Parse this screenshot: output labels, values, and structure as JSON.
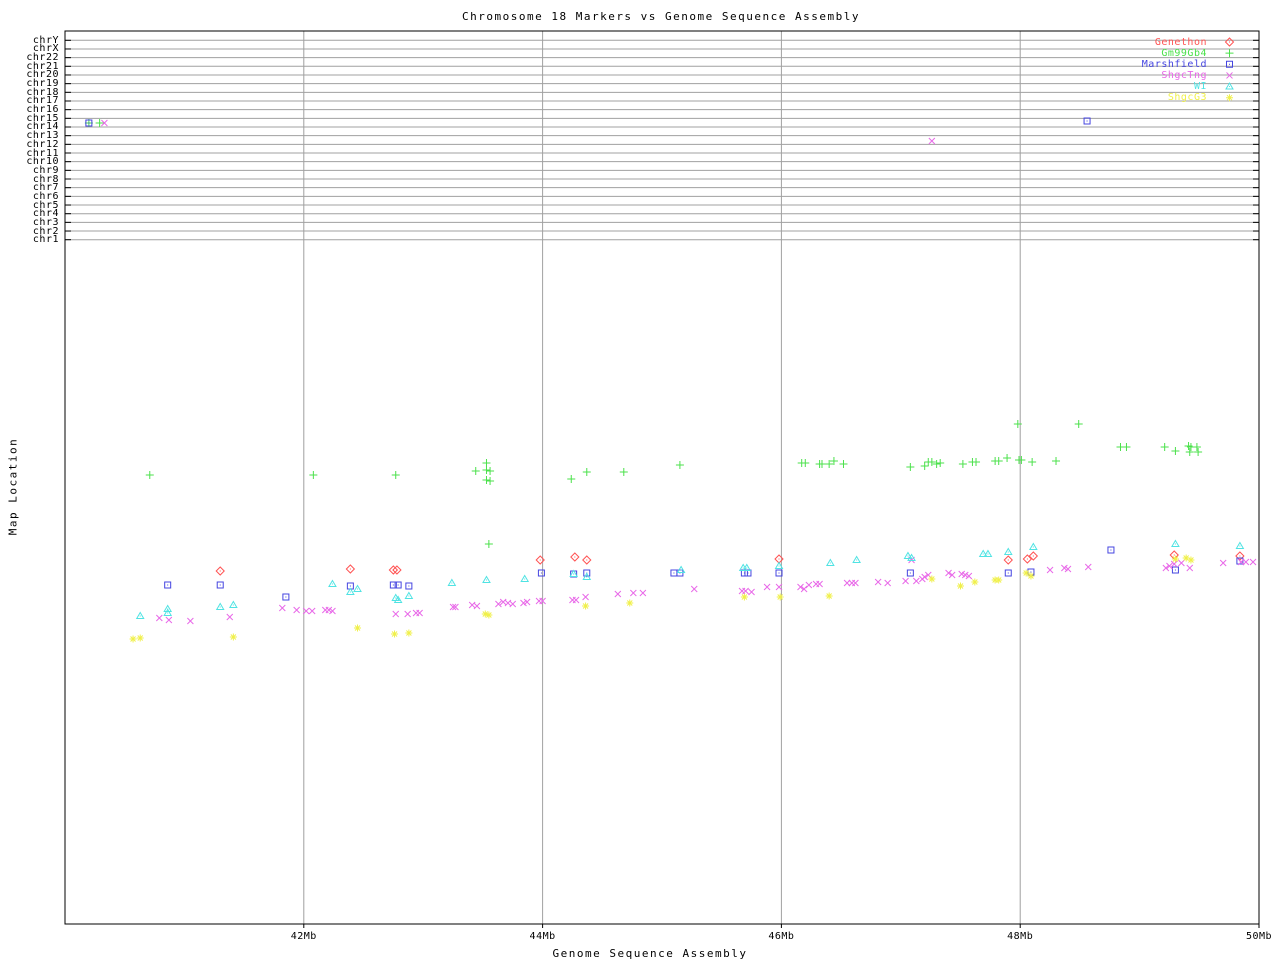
{
  "chart_data": {
    "type": "scatter",
    "title": "Chromosome 18 Markers vs Genome Sequence Assembly",
    "xlabel": "Genome Sequence Assembly",
    "ylabel": "Map Location",
    "x_axis": {
      "range_mb": [
        40,
        50
      ],
      "ticks": [
        {
          "mb": 42,
          "label": "42Mb",
          "grid": true
        },
        {
          "mb": 44,
          "label": "44Mb",
          "grid": true
        },
        {
          "mb": 46,
          "label": "46Mb",
          "grid": true
        },
        {
          "mb": 48,
          "label": "48Mb",
          "grid": true
        },
        {
          "mb": 50,
          "label": "50Mb",
          "grid": false
        }
      ]
    },
    "y_axis": {
      "rows": [
        "chrY",
        "chrX",
        "chr22",
        "chr21",
        "chr20",
        "chr19",
        "chr18",
        "chr17",
        "chr16",
        "chr15",
        "chr14",
        "chr13",
        "chr12",
        "chr11",
        "chr10",
        "chr9",
        "chr8",
        "chr7",
        "chr6",
        "chr5",
        "chr4",
        "chr3",
        "chr2",
        "chr1"
      ],
      "units_note": "chromosome bands at top; lower region is chr18 map location (no numeric scale shown); point y given in screen px"
    },
    "legend": {
      "position": "top-right"
    },
    "series": [
      {
        "name": "Genethon",
        "marker": "diamond",
        "color": "#ff5252",
        "points": [
          [
            41.3,
            571
          ],
          [
            42.39,
            569
          ],
          [
            42.75,
            570
          ],
          [
            42.78,
            570
          ],
          [
            43.98,
            560
          ],
          [
            44.27,
            557
          ],
          [
            44.37,
            560
          ],
          [
            45.98,
            559
          ],
          [
            47.9,
            560
          ],
          [
            48.06,
            559
          ],
          [
            48.11,
            556
          ],
          [
            49.29,
            555
          ],
          [
            49.84,
            556
          ]
        ]
      },
      {
        "name": "Gm99Gb4",
        "marker": "plus",
        "color": "#4be14b",
        "points": [
          [
            40.2,
            123
          ],
          [
            40.29,
            123
          ],
          [
            40.71,
            475
          ],
          [
            42.08,
            475
          ],
          [
            42.77,
            475
          ],
          [
            43.44,
            471
          ],
          [
            43.53,
            463
          ],
          [
            43.53,
            470
          ],
          [
            43.56,
            471
          ],
          [
            43.53,
            480
          ],
          [
            43.56,
            481
          ],
          [
            43.55,
            544
          ],
          [
            44.24,
            479
          ],
          [
            44.37,
            472
          ],
          [
            44.68,
            472
          ],
          [
            45.15,
            465
          ],
          [
            46.17,
            463
          ],
          [
            46.2,
            463
          ],
          [
            46.32,
            464
          ],
          [
            46.34,
            464
          ],
          [
            46.4,
            464
          ],
          [
            46.44,
            461
          ],
          [
            46.52,
            464
          ],
          [
            47.08,
            467
          ],
          [
            47.2,
            466
          ],
          [
            47.23,
            462
          ],
          [
            47.26,
            462
          ],
          [
            47.3,
            464
          ],
          [
            47.33,
            463
          ],
          [
            47.52,
            464
          ],
          [
            47.6,
            462
          ],
          [
            47.63,
            462
          ],
          [
            47.79,
            461
          ],
          [
            47.82,
            461
          ],
          [
            47.89,
            458
          ],
          [
            47.98,
            424
          ],
          [
            47.99,
            460
          ],
          [
            48.01,
            460
          ],
          [
            48.1,
            462
          ],
          [
            48.3,
            461
          ],
          [
            48.49,
            424
          ],
          [
            48.84,
            447
          ],
          [
            48.89,
            447
          ],
          [
            49.21,
            447
          ],
          [
            49.3,
            451
          ],
          [
            49.41,
            446
          ],
          [
            49.43,
            447
          ],
          [
            49.42,
            452
          ],
          [
            49.48,
            447
          ],
          [
            49.49,
            452
          ]
        ]
      },
      {
        "name": "Marshfield",
        "marker": "square",
        "color": "#4545e0",
        "points": [
          [
            40.2,
            123
          ],
          [
            40.86,
            585
          ],
          [
            41.3,
            585
          ],
          [
            41.85,
            597
          ],
          [
            42.39,
            586
          ],
          [
            42.75,
            585
          ],
          [
            42.79,
            585
          ],
          [
            42.88,
            586
          ],
          [
            43.99,
            573
          ],
          [
            44.26,
            574
          ],
          [
            44.37,
            573
          ],
          [
            45.1,
            573
          ],
          [
            45.15,
            573
          ],
          [
            45.69,
            573
          ],
          [
            45.72,
            573
          ],
          [
            45.98,
            573
          ],
          [
            47.08,
            573
          ],
          [
            47.9,
            573
          ],
          [
            48.09,
            572
          ],
          [
            48.56,
            121
          ],
          [
            48.76,
            550
          ],
          [
            49.3,
            570
          ],
          [
            49.84,
            561
          ]
        ]
      },
      {
        "name": "ShgcTng",
        "marker": "xmark",
        "color": "#e868e8",
        "points": [
          [
            40.33,
            123
          ],
          [
            40.79,
            618
          ],
          [
            40.87,
            620
          ],
          [
            41.05,
            621
          ],
          [
            41.38,
            617
          ],
          [
            41.82,
            608
          ],
          [
            41.94,
            610
          ],
          [
            42.02,
            611
          ],
          [
            42.07,
            611
          ],
          [
            42.18,
            610
          ],
          [
            42.21,
            610
          ],
          [
            42.24,
            611
          ],
          [
            42.77,
            614
          ],
          [
            42.87,
            614
          ],
          [
            42.94,
            613
          ],
          [
            42.97,
            613
          ],
          [
            43.25,
            607
          ],
          [
            43.27,
            607
          ],
          [
            43.41,
            605
          ],
          [
            43.45,
            606
          ],
          [
            43.63,
            604
          ],
          [
            43.67,
            602
          ],
          [
            43.71,
            603
          ],
          [
            43.75,
            604
          ],
          [
            43.84,
            603
          ],
          [
            43.87,
            602
          ],
          [
            43.97,
            601
          ],
          [
            44.0,
            601
          ],
          [
            44.25,
            600
          ],
          [
            44.28,
            600
          ],
          [
            44.36,
            597
          ],
          [
            44.63,
            594
          ],
          [
            44.76,
            593
          ],
          [
            44.84,
            593
          ],
          [
            45.27,
            589
          ],
          [
            45.67,
            591
          ],
          [
            45.7,
            591
          ],
          [
            45.75,
            592
          ],
          [
            45.88,
            587
          ],
          [
            45.98,
            587
          ],
          [
            46.16,
            587
          ],
          [
            46.19,
            589
          ],
          [
            46.23,
            585
          ],
          [
            46.29,
            584
          ],
          [
            46.32,
            584
          ],
          [
            46.55,
            583
          ],
          [
            46.59,
            583
          ],
          [
            46.62,
            583
          ],
          [
            46.81,
            582
          ],
          [
            46.89,
            583
          ],
          [
            47.04,
            581
          ],
          [
            47.09,
            560
          ],
          [
            47.13,
            581
          ],
          [
            47.18,
            579
          ],
          [
            47.2,
            577
          ],
          [
            47.23,
            575
          ],
          [
            47.26,
            141
          ],
          [
            47.4,
            573
          ],
          [
            47.43,
            575
          ],
          [
            47.51,
            574
          ],
          [
            47.54,
            575
          ],
          [
            47.57,
            576
          ],
          [
            48.25,
            570
          ],
          [
            48.37,
            568
          ],
          [
            48.4,
            569
          ],
          [
            48.57,
            567
          ],
          [
            49.22,
            568
          ],
          [
            49.25,
            566
          ],
          [
            49.29,
            564
          ],
          [
            49.35,
            563
          ],
          [
            49.42,
            568
          ],
          [
            49.7,
            563
          ],
          [
            49.85,
            562
          ],
          [
            49.89,
            562
          ],
          [
            49.95,
            562
          ]
        ]
      },
      {
        "name": "WI",
        "marker": "triangle",
        "color": "#4fe3e3",
        "points": [
          [
            40.63,
            616
          ],
          [
            40.86,
            609
          ],
          [
            40.86,
            613
          ],
          [
            41.3,
            607
          ],
          [
            41.41,
            605
          ],
          [
            42.24,
            584
          ],
          [
            42.39,
            592
          ],
          [
            42.45,
            589
          ],
          [
            42.77,
            598
          ],
          [
            42.79,
            600
          ],
          [
            42.88,
            596
          ],
          [
            43.24,
            583
          ],
          [
            43.53,
            580
          ],
          [
            43.85,
            579
          ],
          [
            44.26,
            574
          ],
          [
            44.37,
            577
          ],
          [
            45.16,
            570
          ],
          [
            45.68,
            568
          ],
          [
            45.71,
            568
          ],
          [
            45.98,
            566
          ],
          [
            46.41,
            563
          ],
          [
            46.63,
            560
          ],
          [
            47.06,
            556
          ],
          [
            47.09,
            558
          ],
          [
            47.69,
            554
          ],
          [
            47.73,
            554
          ],
          [
            47.9,
            552
          ],
          [
            48.11,
            547
          ],
          [
            49.3,
            544
          ],
          [
            49.84,
            546
          ]
        ]
      },
      {
        "name": "ShgcG3",
        "marker": "star",
        "color": "#f0f04a",
        "points": [
          [
            40.57,
            639
          ],
          [
            40.63,
            638
          ],
          [
            41.41,
            637
          ],
          [
            42.45,
            628
          ],
          [
            42.76,
            634
          ],
          [
            42.88,
            633
          ],
          [
            43.52,
            614
          ],
          [
            43.55,
            615
          ],
          [
            44.36,
            606
          ],
          [
            44.73,
            603
          ],
          [
            45.69,
            597
          ],
          [
            45.99,
            597
          ],
          [
            46.4,
            596
          ],
          [
            47.26,
            579
          ],
          [
            47.5,
            586
          ],
          [
            47.62,
            582
          ],
          [
            47.79,
            580
          ],
          [
            47.82,
            580
          ],
          [
            48.05,
            573
          ],
          [
            48.09,
            576
          ],
          [
            49.3,
            559
          ],
          [
            49.39,
            558
          ],
          [
            49.43,
            560
          ]
        ]
      }
    ],
    "colors": {
      "grid": "#a0a0a0",
      "frame": "#000000"
    }
  }
}
